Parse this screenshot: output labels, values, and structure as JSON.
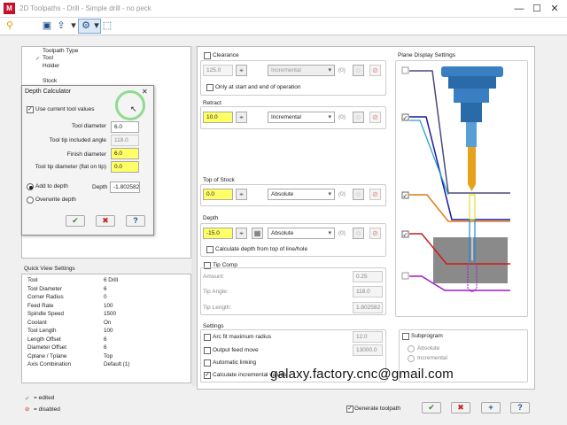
{
  "window": {
    "title": "2D Toolpaths - Drill - Simple drill - no peck",
    "logo": "M",
    "minimize": "—",
    "maximize": "☐",
    "close": "✕"
  },
  "tree": {
    "items": [
      "Toolpath Type",
      "Tool",
      "Holder",
      "Stock"
    ],
    "tool_check": "✓"
  },
  "depth_calc": {
    "title": "Depth Calculator",
    "close": "✕",
    "use_current": "Use current tool values",
    "rows": [
      {
        "label": "Tool diameter",
        "value": "6.0"
      },
      {
        "label": "Tool tip included angle",
        "value": "118.0"
      },
      {
        "label": "Finish diameter",
        "value": "6.0"
      },
      {
        "label": "Tool tip diameter (flat on tip)",
        "value": "0.0"
      }
    ],
    "add_to_depth": "Add to depth",
    "overwrite_depth": "Overwrite depth",
    "depth_label": "Depth",
    "depth_value": "-1.802582",
    "ok": "✔",
    "cancel": "✖",
    "help": "?"
  },
  "quick_view": {
    "title": "Quick View Settings",
    "rows": [
      [
        "Tool",
        "6 Drill"
      ],
      [
        "Tool Diameter",
        "6"
      ],
      [
        "Corner Radius",
        "0"
      ],
      [
        "Feed Rate",
        "100"
      ],
      [
        "Spindle Speed",
        "1500"
      ],
      [
        "Coolant",
        "On"
      ],
      [
        "Tool Length",
        "100"
      ],
      [
        "Length Offset",
        "6"
      ],
      [
        "Diameter Offset",
        "6"
      ],
      [
        "Cplane / Tplane",
        "Top"
      ],
      [
        "Axis Combination",
        "Default (1)"
      ]
    ]
  },
  "legend": {
    "edited": "= edited",
    "disabled": "= disabled",
    "edited_mark": "✓",
    "disabled_mark": "⊘"
  },
  "clearance": {
    "label": "Clearance",
    "value": "125.0",
    "mode": "Incremental",
    "idx": "(0)",
    "only_start_end": "Only at start and end of operation"
  },
  "retract": {
    "label": "Retract",
    "value": "10.0",
    "mode": "Incremental",
    "idx": "(0)"
  },
  "top_of_stock": {
    "label": "Top of Stock",
    "value": "0.0",
    "mode": "Absolute",
    "idx": "(0)"
  },
  "depth": {
    "label": "Depth",
    "value": "-15.0",
    "mode": "Absolute",
    "idx": "(0)",
    "calc_from_top": "Calculate depth from top of line/hole"
  },
  "tip_comp": {
    "label": "Tip Comp",
    "amount_label": "Amount:",
    "amount": "0.25",
    "angle_label": "Tip Angle:",
    "angle": "118.0",
    "length_label": "Tip Length:",
    "length": "1.802582"
  },
  "settings": {
    "title": "Settings",
    "arc_fit": "Arc fit maximum radius",
    "arc_fit_value": "12.0",
    "output_feed": "Output feed move",
    "output_feed_value": "13000.0",
    "auto_link": "Automatic linking",
    "calc_incr": "Calculate incremental values",
    "subprogram": "Subprogram",
    "absolute": "Absolute",
    "incremental": "Incremental"
  },
  "plane_display": {
    "title": "Plane Display Settings"
  },
  "bottom": {
    "generate": "Generate toolpath",
    "ok": "✔",
    "cancel": "✖",
    "add": "+",
    "help": "?"
  },
  "watermark": "galaxy.factory.cnc@gmail.com",
  "colors": {
    "yellow": "#ffff66",
    "accent": "#1d4e89",
    "clearance_line": "#6a6a8a",
    "retract_line": "#1a1aa0",
    "feed_line": "#1aa0c8",
    "stock_line": "#e07b1a",
    "depth_line": "#d01a1a",
    "tip_line": "#a01ac8"
  }
}
